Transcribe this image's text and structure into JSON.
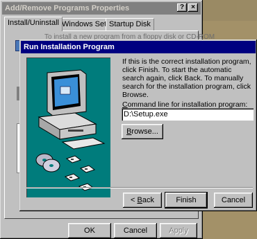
{
  "outer_dialog": {
    "title": "Add/Remove Programs Properties",
    "help_glyph": "?",
    "close_glyph": "×",
    "tabs": [
      {
        "label": "Install/Uninstall",
        "active": true
      },
      {
        "label": "Windows Setup",
        "active": false
      },
      {
        "label": "Startup Disk",
        "active": false
      }
    ],
    "background_text": "To install a new program from a floppy disk or CD-ROM",
    "buttons": {
      "ok": "OK",
      "cancel": "Cancel",
      "apply": "Apply"
    }
  },
  "wizard": {
    "title": "Run Installation Program",
    "instructions": "If this is the correct installation program, click Finish. To start the automatic search again, click Back. To manually search for the installation program, click Browse.",
    "command_label_mnemonic": "C",
    "command_label_rest": "ommand line for installation program:",
    "command_value": "D:\\Setup.exe",
    "browse_mnemonic": "B",
    "browse_rest": "rowse...",
    "back_prefix": "< ",
    "back_mnemonic": "B",
    "back_rest": "ack",
    "finish": "Finish",
    "cancel": "Cancel"
  },
  "colors": {
    "active_title": "#000080",
    "inactive_title": "#808080",
    "panel_art": "#007c7c",
    "face": "#c0c0c0"
  }
}
